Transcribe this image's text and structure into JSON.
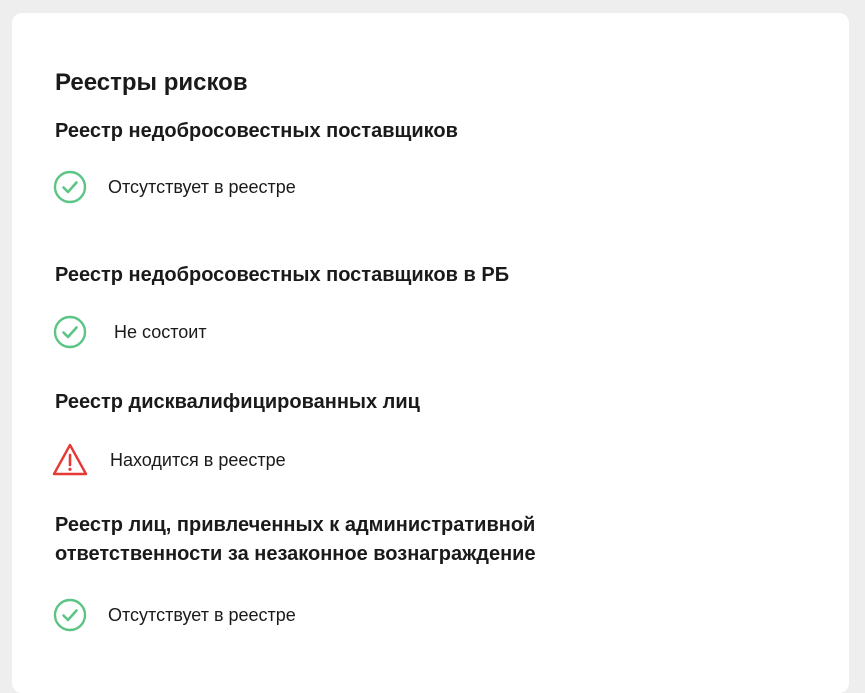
{
  "card": {
    "title": "Реестры рисков"
  },
  "registries": [
    {
      "title": "Реестр недобросовестных поставщиков",
      "status": "Отсутствует в реестре",
      "icon": "check-circle-icon",
      "state": "ok"
    },
    {
      "title": "Реестр недобросовестных поставщиков в РБ",
      "status": "Не состоит",
      "icon": "check-circle-icon",
      "state": "ok"
    },
    {
      "title": "Реестр дисквалифицированных лиц",
      "status": "Находится в реестре",
      "icon": "warning-triangle-icon",
      "state": "warning"
    },
    {
      "title_line1": "Реестр лиц, привлеченных к административной",
      "title_line2": "ответственности за незаконное вознаграждение",
      "status": "Отсутствует в реестре",
      "icon": "check-circle-icon",
      "state": "ok"
    }
  ],
  "colors": {
    "ok": "#5cc585",
    "warning": "#e53935",
    "background": "#eeeeee",
    "card": "#ffffff",
    "text": "#1a1a1a"
  }
}
